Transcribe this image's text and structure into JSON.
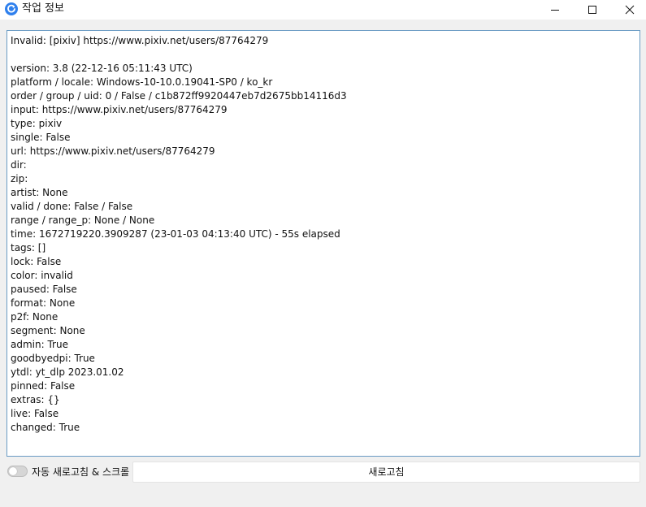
{
  "window": {
    "title": "작업 정보",
    "colors": {
      "accent": "#2f80ed",
      "border": "#6a9bc4"
    }
  },
  "log": {
    "lines": [
      "Invalid: [pixiv] https://www.pixiv.net/users/87764279",
      "",
      "version: 3.8 (22-12-16 05:11:43 UTC)",
      "platform / locale: Windows-10-10.0.19041-SP0 / ko_kr",
      "order / group / uid: 0 / False / c1b872ff9920447eb7d2675bb14116d3",
      "input: https://www.pixiv.net/users/87764279",
      "type: pixiv",
      "single: False",
      "url: https://www.pixiv.net/users/87764279",
      "dir:",
      "zip:",
      "artist: None",
      "valid / done: False / False",
      "range / range_p: None / None",
      "time: 1672719220.3909287 (23-01-03 04:13:40 UTC) - 55s elapsed",
      "tags: []",
      "lock: False",
      "color: invalid",
      "paused: False",
      "format: None",
      "p2f: None",
      "segment: None",
      "admin: True",
      "goodbyedpi: True",
      "ytdl: yt_dlp 2023.01.02",
      "pinned: False",
      "extras: {}",
      "live: False",
      "changed: True"
    ]
  },
  "footer": {
    "toggle_label": "자동 새로고침 & 스크롤",
    "toggle_on": false,
    "refresh_label": "새로고침"
  }
}
